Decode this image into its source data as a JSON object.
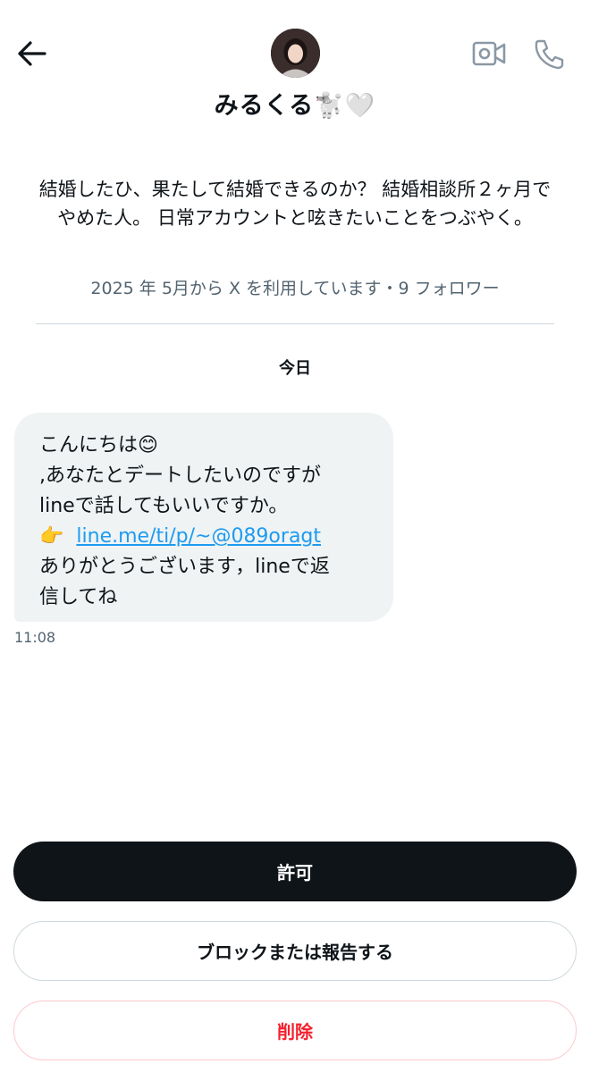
{
  "header": {
    "back_icon": "arrow-left-icon",
    "video_icon": "video-call-icon",
    "phone_icon": "phone-icon",
    "name": "みるくる🐩🤍"
  },
  "profile": {
    "bio": "結婚したひ、果たして結婚できるのか？ 結婚相談所２ヶ月でやめた人。 日常アカウントと呟きたいことをつぶやく。",
    "joined": "2025 年 5月から X を利用しています・9 フォロワー"
  },
  "conversation": {
    "date_label": "今日",
    "message": {
      "line1": "こんにちは😊",
      "line2": ",あなたとデートしたいのですが",
      "line3": "lineで話してもいいですか。",
      "pointer": "👉",
      "link": "line.me/ti/p/~@089oragt",
      "line5": "ありがとうございます，lineで返",
      "line6": "信してね",
      "time": "11:08"
    }
  },
  "actions": {
    "allow_label": "許可",
    "block_label": "ブロックまたは報告する",
    "delete_label": "削除"
  },
  "colors": {
    "link": "#1d9bf0",
    "delete": "#f4212e",
    "primary_button": "#0f1419",
    "bubble": "#eff3f4"
  }
}
